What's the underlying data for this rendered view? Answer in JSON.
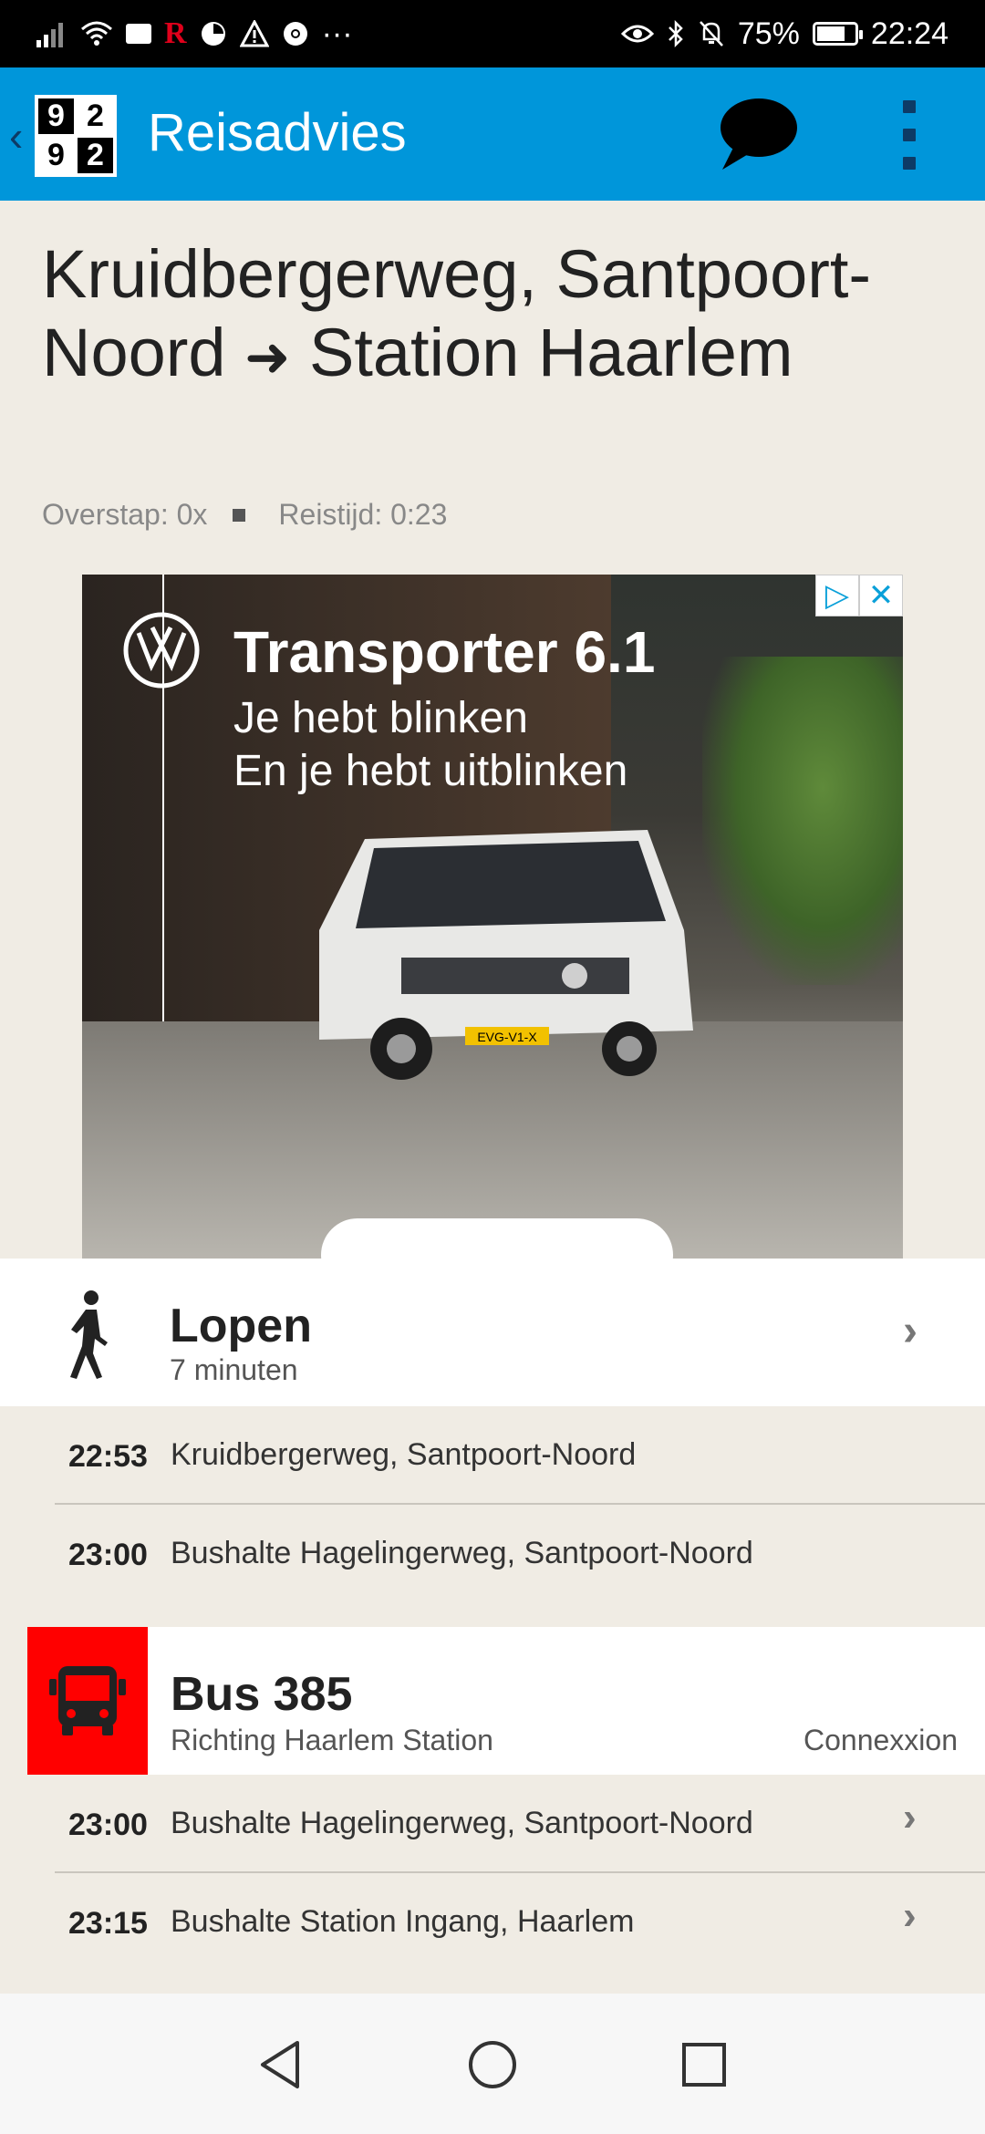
{
  "status_bar": {
    "battery": "75%",
    "battery_level": 0.75,
    "time": "22:24",
    "more": "···"
  },
  "app_bar": {
    "logo_digits": [
      "9",
      "2",
      "9",
      "2"
    ],
    "title": "Reisadvies"
  },
  "journey": {
    "origin": "Kruidbergerweg, Santpoort-Noord",
    "destination": "Station Haarlem",
    "transfers": "Overstap: 0x",
    "travel_time": "Reistijd: 0:23"
  },
  "ad": {
    "headline": "Transporter 6.1",
    "line1": "Je hebt blinken",
    "line2": "En je hebt uitblinken",
    "plate": "EVG-V1-X"
  },
  "legs": {
    "walk": {
      "name": "Lopen",
      "duration": "7 minuten",
      "stops": [
        {
          "time": "22:53",
          "name": "Kruidbergerweg, Santpoort-Noord"
        },
        {
          "time": "23:00",
          "name": "Bushalte Hagelingerweg, Santpoort-Noord"
        }
      ]
    },
    "bus": {
      "name": "Bus 385",
      "direction": "Richting Haarlem Station",
      "operator": "Connexxion",
      "color": "#ff0000",
      "stops": [
        {
          "time": "23:00",
          "name": "Bushalte Hagelingerweg, Santpoort-Noord"
        },
        {
          "time": "23:15",
          "name": "Bushalte Station Ingang, Haarlem"
        }
      ]
    }
  },
  "colors": {
    "app_bar": "#0096da",
    "background": "#f0ece4",
    "bus_badge": "#ff0000"
  }
}
